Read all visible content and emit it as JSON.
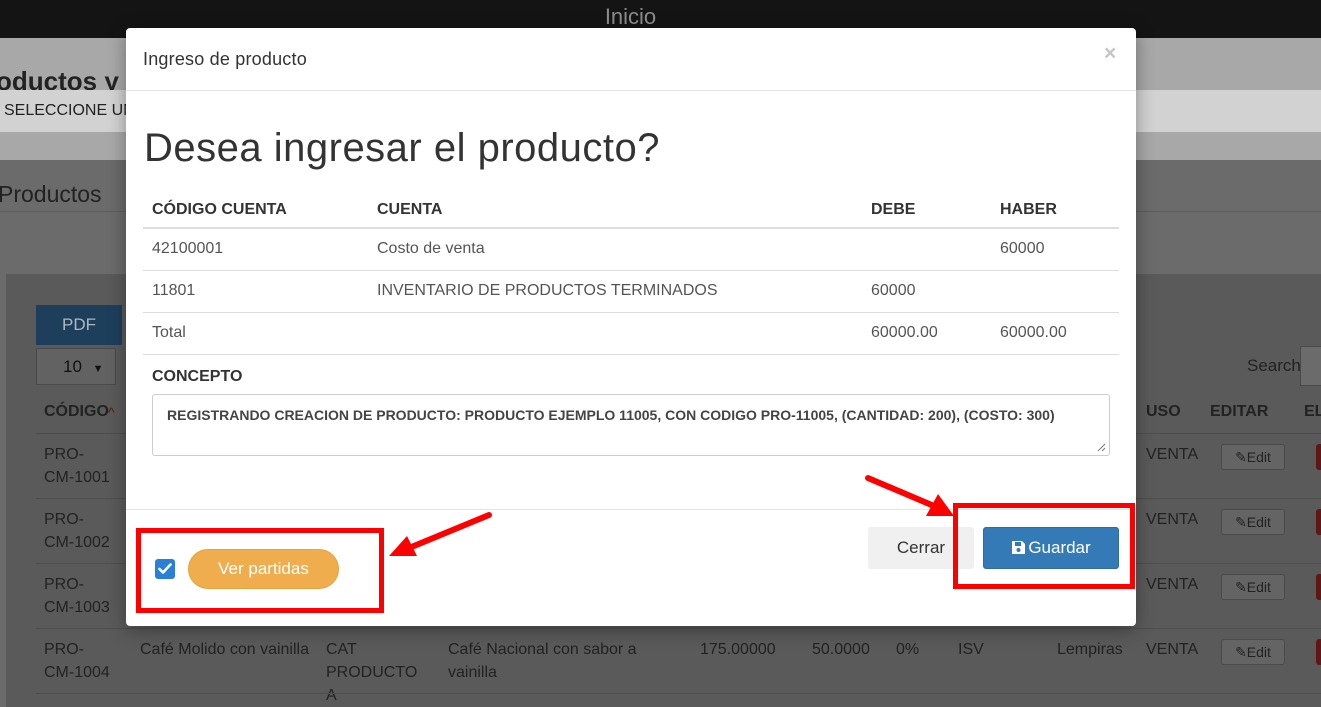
{
  "topbar": {
    "title": "Inicio"
  },
  "background": {
    "heading": "oductos y S",
    "select_prompt": "SELECCIONE UN",
    "section_title": "Productos",
    "pdf_button": "PDF",
    "page_length": "10",
    "search_label": "Search:",
    "columns": {
      "codigo": "CÓDIGO",
      "uso": "USO",
      "editar": "EDITAR",
      "eliminar": "EL"
    },
    "edit_label": "Edit",
    "rows": [
      {
        "code": "PRO-CM-1001",
        "uso": "VENTA"
      },
      {
        "code": "PRO-CM-1002",
        "uso": "VENTA"
      },
      {
        "code": "PRO-CM-1003",
        "uso": "VENTA"
      },
      {
        "code": "PRO-CM-1004",
        "name": "Café Molido con vainilla",
        "category": "CAT PRODUCTO A",
        "description": "Café Nacional con sabor a vainilla",
        "price": "175.00000",
        "cost": "50.0000",
        "discount": "0%",
        "tax": "ISV",
        "currency": "Lempiras",
        "uso": "VENTA"
      }
    ]
  },
  "modal": {
    "title": "Ingreso de producto",
    "close_symbol": "×",
    "question": "Desea ingresar el producto?",
    "table": {
      "headers": [
        "CÓDIGO CUENTA",
        "CUENTA",
        "DEBE",
        "HABER"
      ],
      "rows": [
        [
          "42100001",
          "Costo de venta",
          "",
          "60000"
        ],
        [
          "11801",
          "INVENTARIO DE PRODUCTOS TERMINADOS",
          "60000",
          ""
        ],
        [
          "Total",
          "",
          "60000.00",
          "60000.00"
        ]
      ]
    },
    "concepto_label": "CONCEPTO",
    "concepto_value": "REGISTRANDO CREACION DE PRODUCTO: PRODUCTO EJEMPLO 11005, CON CODIGO PRO-11005, (CANTIDAD: 200), (COSTO: 300)",
    "checkbox_checked": true,
    "ver_partidas_label": "Ver partidas",
    "cerrar_label": "Cerrar",
    "guardar_label": "Guardar"
  },
  "colors": {
    "primary": "#337ab7",
    "warning": "#f0ad4e",
    "annotation": "#ff0000"
  },
  "icons": {
    "save": "floppy-disk-icon",
    "edit": "pencil-icon",
    "close": "close-icon",
    "check": "check-icon",
    "sort": "sort-asc-icon"
  }
}
